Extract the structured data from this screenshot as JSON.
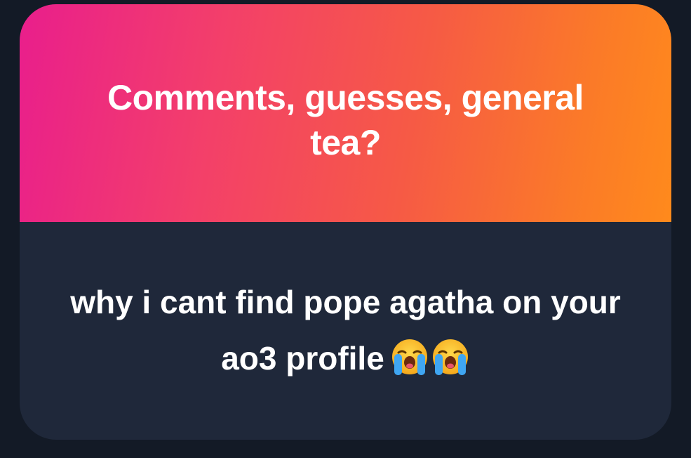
{
  "card": {
    "prompt": "Comments, guesses, general tea?",
    "response": "why i cant find pope agatha on your ao3 profile",
    "emojis": [
      "loudly-crying-face-icon",
      "loudly-crying-face-icon"
    ]
  },
  "colors": {
    "background": "#131a26",
    "card_body": "#1f283a",
    "gradient_start": "#e91e8c",
    "gradient_end": "#ff8a1c",
    "text": "#ffffff"
  }
}
